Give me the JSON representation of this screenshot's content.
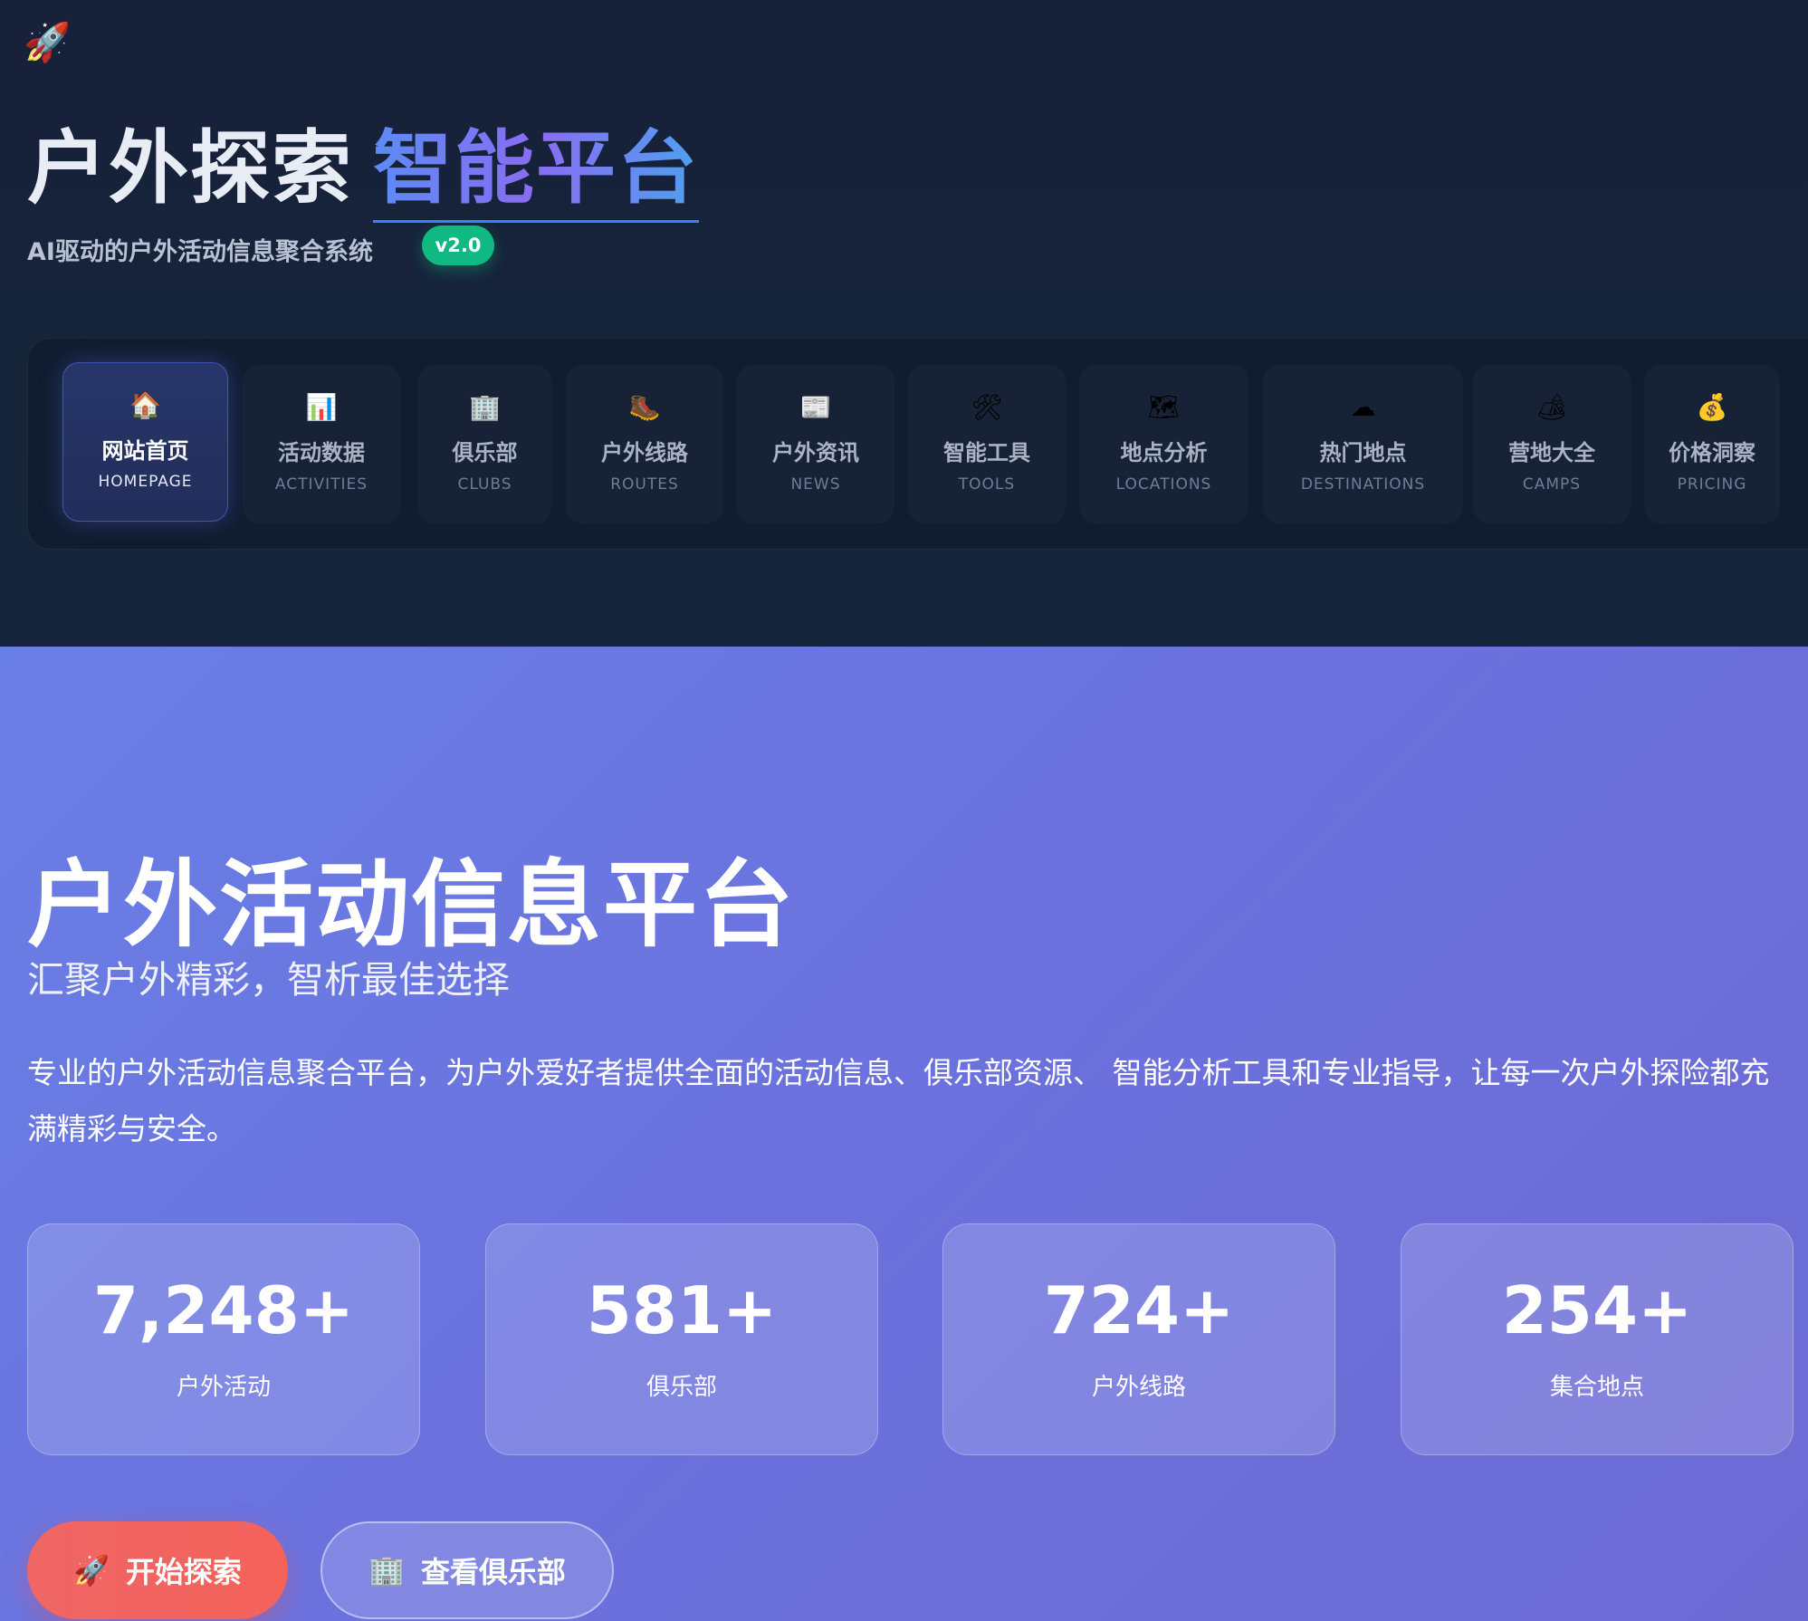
{
  "header": {
    "logo_icon": "🚀",
    "title_main": "户外探索",
    "title_accent": "智能平台",
    "tagline": "AI驱动的户外活动信息聚合系统",
    "version": "v2.0",
    "accent_color": "#3b82f6",
    "badge_color": "#10b981"
  },
  "nav": [
    {
      "icon": "🏠",
      "icon_name": "house-icon",
      "label": "网站首页",
      "label_en": "HOMEPAGE",
      "active": true
    },
    {
      "icon": "📊",
      "icon_name": "bar-chart-icon",
      "label": "活动数据",
      "label_en": "ACTIVITIES",
      "active": false
    },
    {
      "icon": "🏢",
      "icon_name": "building-icon",
      "label": "俱乐部",
      "label_en": "CLUBS",
      "active": false
    },
    {
      "icon": "🥾",
      "icon_name": "hiking-boot-icon",
      "label": "户外线路",
      "label_en": "ROUTES",
      "active": false
    },
    {
      "icon": "📰",
      "icon_name": "newspaper-icon",
      "label": "户外资讯",
      "label_en": "NEWS",
      "active": false
    },
    {
      "icon": "🛠",
      "icon_name": "tools-icon",
      "label": "智能工具",
      "label_en": "TOOLS",
      "active": false
    },
    {
      "icon": "🗺",
      "icon_name": "map-icon",
      "label": "地点分析",
      "label_en": "LOCATIONS",
      "active": false
    },
    {
      "icon": "☁",
      "icon_name": "cloud-icon",
      "label": "热门地点",
      "label_en": "DESTINATIONS",
      "active": false
    },
    {
      "icon": "🏕",
      "icon_name": "camping-icon",
      "label": "营地大全",
      "label_en": "CAMPS",
      "active": false
    },
    {
      "icon": "💰",
      "icon_name": "money-bag-icon",
      "label": "价格洞察",
      "label_en": "PRICING",
      "active": false
    }
  ],
  "hero": {
    "title": "户外活动信息平台",
    "subtitle": "汇聚户外精彩，智析最佳选择",
    "description": "专业的户外活动信息聚合平台，为户外爱好者提供全面的活动信息、俱乐部资源、 智能分析工具和专业指导，让每一次户外探险都充满精彩与安全。",
    "stats": [
      {
        "value": "7,248+",
        "label": "户外活动"
      },
      {
        "value": "581+",
        "label": "俱乐部"
      },
      {
        "value": "724+",
        "label": "户外线路"
      },
      {
        "value": "254+",
        "label": "集合地点"
      }
    ],
    "buttons": {
      "primary_icon": "🚀",
      "primary_label": "开始探索",
      "secondary_icon": "🏢",
      "secondary_label": "查看俱乐部"
    }
  }
}
